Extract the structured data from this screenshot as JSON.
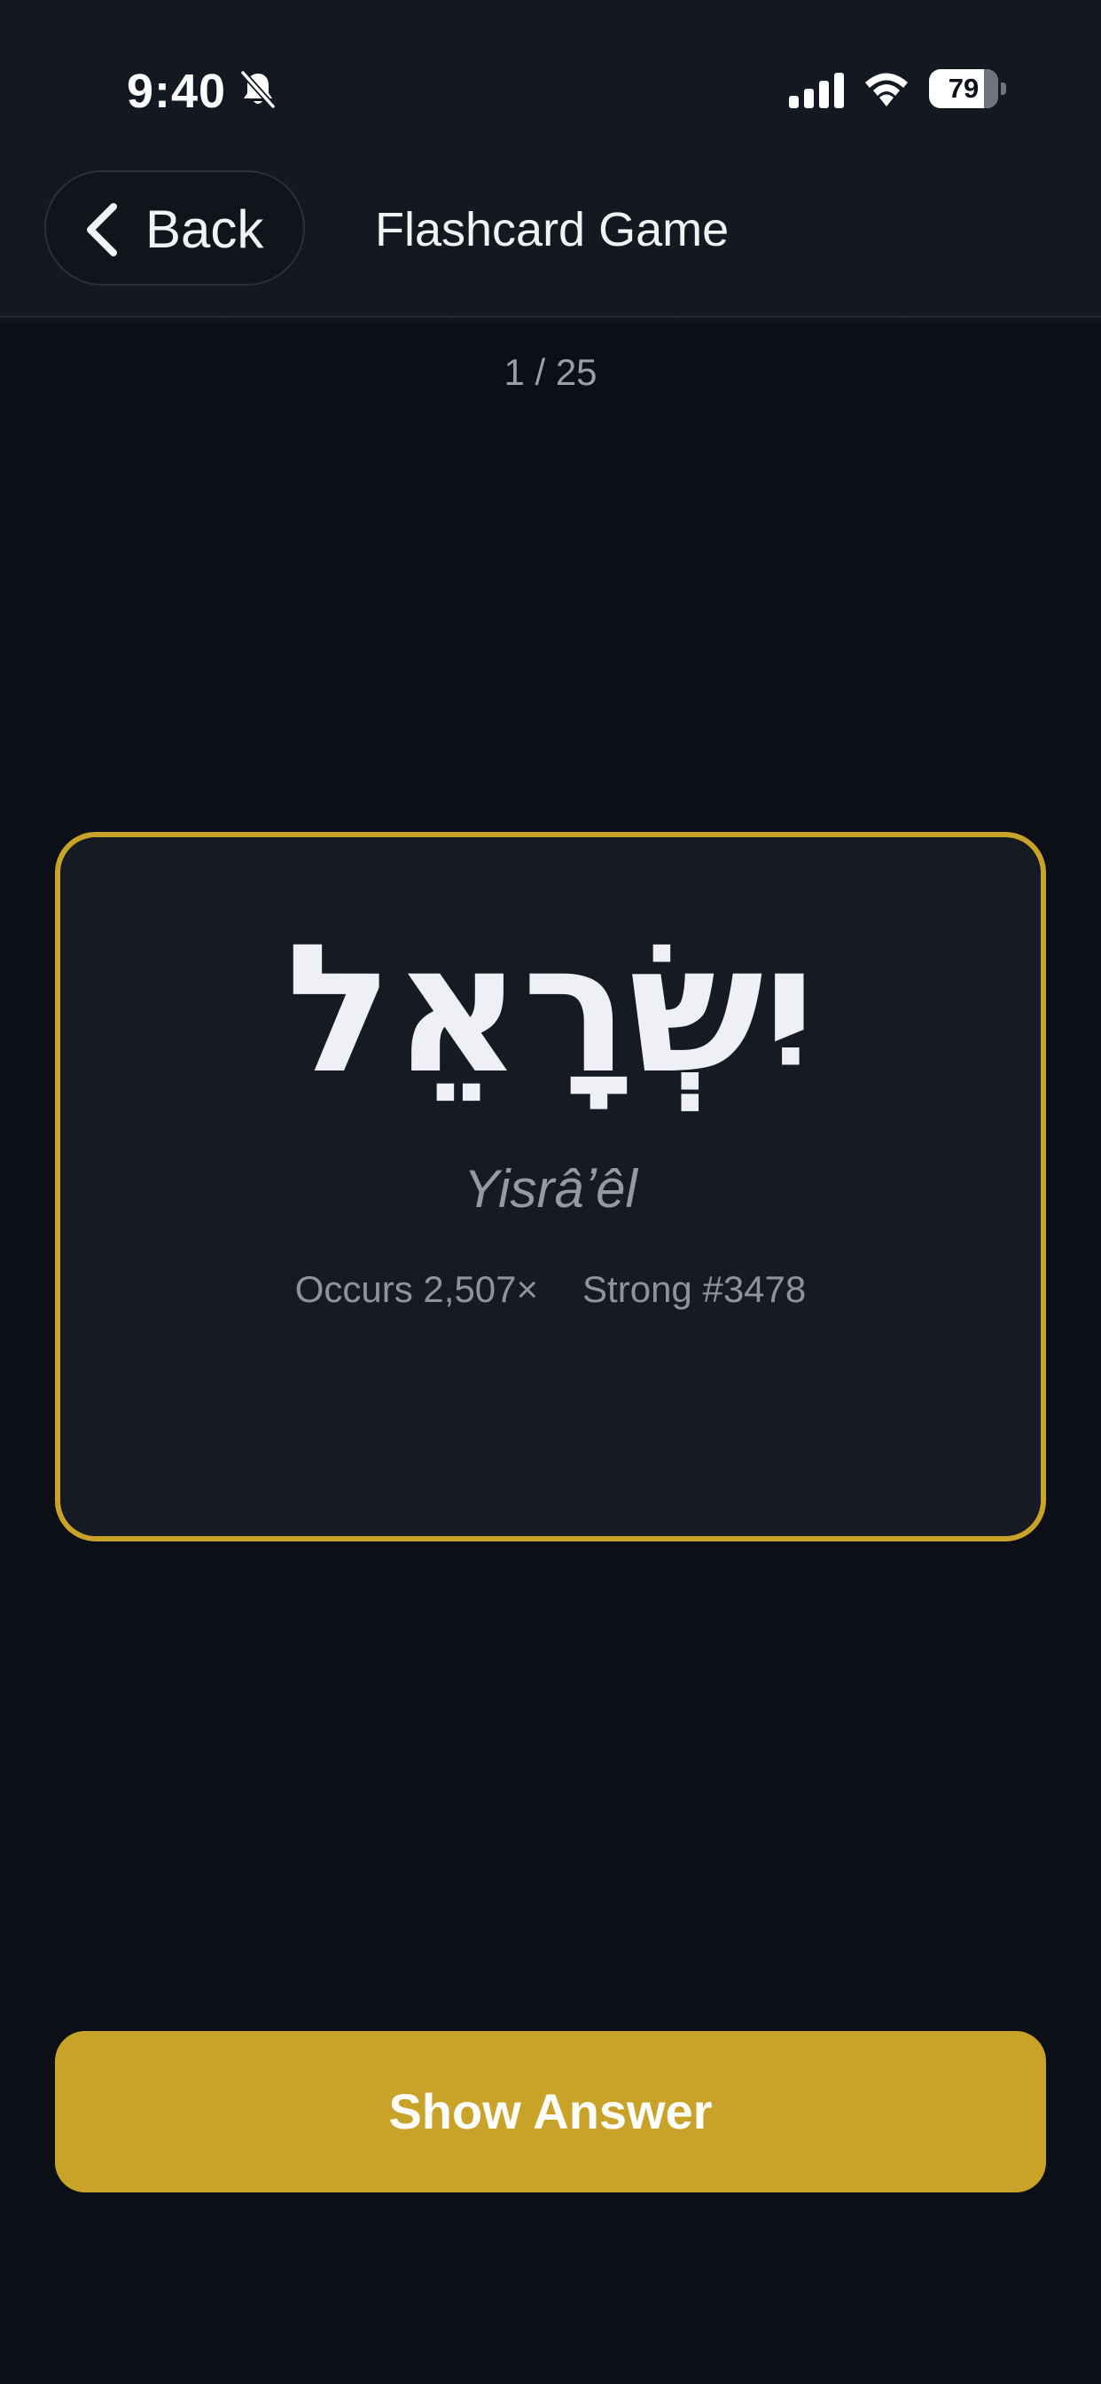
{
  "status_bar": {
    "time": "9:40",
    "battery_level": "79",
    "battery_fraction": 0.79,
    "icons": [
      "bell-slash-icon",
      "cellular-signal-icon",
      "wifi-icon",
      "battery-icon"
    ]
  },
  "header": {
    "back_label": "Back",
    "back_icon": "chevron-left-icon",
    "title": "Flashcard Game"
  },
  "progress": {
    "label": "1 / 25",
    "current": 1,
    "total": 25
  },
  "card": {
    "word": "יִשְׂרָאֵל",
    "transliteration": "Yisrâʼêl",
    "occurs": "Occurs 2,507×",
    "strong": "Strong #3478"
  },
  "actions": {
    "show_answer_label": "Show Answer"
  },
  "colors": {
    "accent": "#c9a229",
    "background": "#0c0f16",
    "header_background": "#141921",
    "card_background": "#161a22"
  }
}
